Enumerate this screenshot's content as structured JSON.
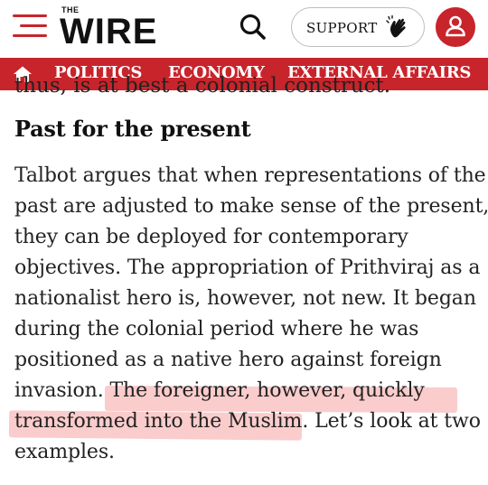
{
  "header": {
    "logo_small": "THE",
    "logo_main": "WIRE",
    "support_label": "SUPPORT"
  },
  "nav": {
    "items": [
      {
        "label": "POLITICS"
      },
      {
        "label": "ECONOMY"
      },
      {
        "label": "EXTERNAL AFFAIRS"
      }
    ]
  },
  "article": {
    "partial_previous_line": "thus, is at best a colonial construct.",
    "section_heading": "Past for the present",
    "paragraph_lines": [
      "Talbot argues that when representations of the",
      "past are adjusted to make sense of the present,",
      "they can be deployed for contemporary",
      "objectives. The appropriation of Prithviraj as a",
      "nationalist hero is, however, not new. It began",
      "during the colonial period where he was",
      "positioned as a native hero against foreign",
      "invasion. The foreigner, however, quickly",
      "transformed into the Muslim. Let’s look at two",
      "examples."
    ],
    "highlighted_text": "The foreigner, however, quickly transformed into the Muslim"
  },
  "colors": {
    "brand_red": "#c8242b",
    "highlight": "#f7b0b0"
  },
  "icons": {
    "menu": "hamburger-icon",
    "search": "search-icon",
    "support": "clapping-hands-icon",
    "account": "user-icon",
    "home": "home-icon"
  }
}
